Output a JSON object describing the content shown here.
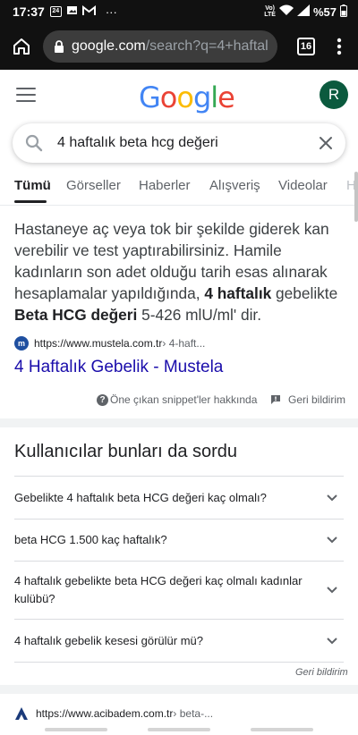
{
  "status_bar": {
    "time": "17:37",
    "date_badge": "24",
    "more": "···",
    "network": "LTE",
    "battery": "%57"
  },
  "browser": {
    "url_domain": "google.com",
    "url_path": "/search?q=4+haftal",
    "tab_count": "16"
  },
  "header": {
    "logo_letters": [
      "G",
      "o",
      "o",
      "g",
      "l",
      "e"
    ],
    "logo_colors": [
      "#4285f4",
      "#ea4335",
      "#fbbc05",
      "#4285f4",
      "#34a853",
      "#ea4335"
    ],
    "avatar_letter": "R",
    "avatar_color": "#0b5a3e"
  },
  "search": {
    "query": "4 haftalık beta hcg değeri"
  },
  "tabs": [
    "Tümü",
    "Görseller",
    "Haberler",
    "Alışveriş",
    "Videolar",
    "H"
  ],
  "snippet": {
    "text_1": "Hastaneye aç veya tok bir şekilde giderek kan verebilir ve test yaptırabilirsiniz. Hamile kadınların son adet olduğu tarih esas alınarak hesaplamalar yapıldığında, ",
    "bold_1": "4 haftalık",
    "text_2": " gebelikte ",
    "bold_2": "Beta HCG değeri",
    "text_3": " 5-426 mlU/ml' dir.",
    "source_favicon": "m",
    "source_url": "https://www.mustela.com.tr",
    "source_crumb": " › 4-haft...",
    "link_title": "4 Haftalık Gebelik - Mustela",
    "about_label": "Öne çıkan snippet'ler hakkında",
    "feedback_label": "Geri bildirim"
  },
  "people_also_ask": {
    "title": "Kullanıcılar bunları da sordu",
    "questions": [
      "Gebelikte 4 haftalık beta HCG değeri kaç olmalı?",
      "beta HCG 1.500 kaç haftalık?",
      "4 haftalık gebelikte beta HCG değeri kaç olmalı kadınlar kulübü?",
      "4 haftalık gebelik kesesi görülür mü?"
    ],
    "feedback_label": "Geri bildirim"
  },
  "next_result": {
    "url": "https://www.acibadem.com.tr",
    "crumb": " › beta-..."
  }
}
